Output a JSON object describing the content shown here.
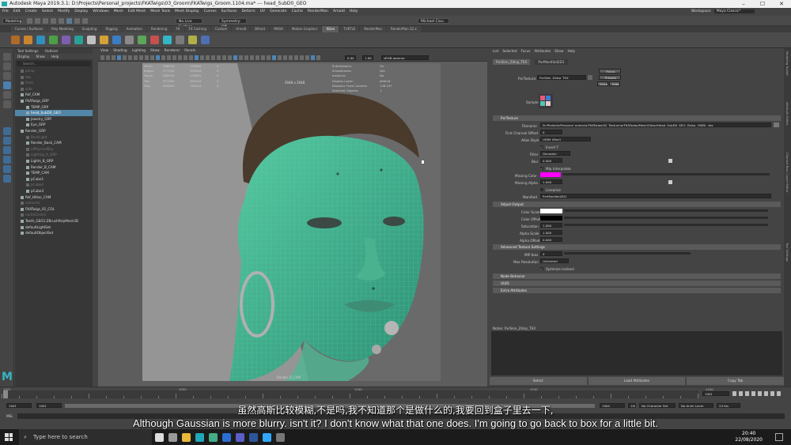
{
  "window": {
    "title": "Autodesk Maya 2019.3.1: D:\\Projects\\Personal_projects\\FKATwigs\\03_Groom\\FKATwigs_Groom.1104.ma* --- head_SubD0_GEO"
  },
  "menubar": {
    "items": [
      "File",
      "Edit",
      "Create",
      "Select",
      "Modify",
      "Display",
      "Windows",
      "Mesh",
      "Edit Mesh",
      "Mesh Tools",
      "Mesh Display",
      "Curves",
      "Surfaces",
      "Deform",
      "UV",
      "Generate",
      "Cache",
      "RenderMan",
      "Arnold",
      "Help"
    ]
  },
  "workspace": {
    "label": "Workspace:",
    "value": "Maya Classic*"
  },
  "status": {
    "mode": "Modeling",
    "no_live": "No Live Surface",
    "symmetry": "Symmetry: Off",
    "user": "Michael Cieu"
  },
  "shelf_tabs": [
    "Curves / Surfaces",
    "Poly Modeling",
    "Sculpting",
    "Rigging",
    "Animation",
    "Rendering",
    "FX",
    "FX Caching",
    "Custom",
    "Arnold",
    "Bifrost",
    "MASH",
    "Motion Graphics",
    "XGen",
    "TURTLE",
    "RenderMan",
    "RenderMan 22.x"
  ],
  "outliner": {
    "tabs": [
      "Tool Settings",
      "Outliner"
    ],
    "menu": [
      "Display",
      "Show",
      "Help"
    ],
    "search_placeholder": "Search...",
    "items": [
      {
        "label": "persp",
        "dim": true,
        "indent": 1
      },
      {
        "label": "top",
        "dim": true,
        "indent": 1
      },
      {
        "label": "front",
        "dim": true,
        "indent": 1
      },
      {
        "label": "side",
        "dim": true,
        "indent": 1
      },
      {
        "label": "Ref_CAM",
        "indent": 1
      },
      {
        "label": "FKATwigs_GRP",
        "indent": 1
      },
      {
        "label": "TEMP_GRP",
        "indent": 2
      },
      {
        "label": "head_SubD0_GEO",
        "indent": 2,
        "selected": true
      },
      {
        "label": "Jewelry_GRP",
        "indent": 2
      },
      {
        "label": "Eye_GRP",
        "indent": 2
      },
      {
        "label": "Render_GRP",
        "indent": 1
      },
      {
        "label": "BackLight",
        "dim": true,
        "indent": 2
      },
      {
        "label": "Render_Back_CAM",
        "indent": 2
      },
      {
        "label": "aiPhysicalSky",
        "dim": true,
        "indent": 2
      },
      {
        "label": "Lighting_A_GRP",
        "dim": true,
        "indent": 2
      },
      {
        "label": "Lights_B_GRP",
        "indent": 2
      },
      {
        "label": "Render_B_CAM",
        "indent": 2
      },
      {
        "label": "TEMP_CAM",
        "indent": 2
      },
      {
        "label": "pCube1",
        "indent": 2
      },
      {
        "label": "pCube2",
        "dim": true,
        "indent": 2
      },
      {
        "label": "pCube3",
        "indent": 2
      },
      {
        "label": "Ref_Hiltac_CAM",
        "indent": 1
      },
      {
        "label": "camera1",
        "dim": true,
        "indent": 1
      },
      {
        "label": "FKATwigs_01_COL",
        "indent": 1
      },
      {
        "label": "nurbsCircle1",
        "dim": true,
        "indent": 1
      },
      {
        "label": "Teeth_GEO1:ZBrushPolyMesh3D",
        "indent": 1
      },
      {
        "label": "defaultLightSet",
        "indent": 1
      },
      {
        "label": "defaultObjectSet",
        "indent": 1
      }
    ]
  },
  "viewport": {
    "menu": [
      "View",
      "Shading",
      "Lighting",
      "Show",
      "Renderer",
      "Panels"
    ],
    "exposure": "0.00",
    "gamma": "1.00",
    "color_space": "sRGB gamma",
    "resolution": "2048 x 2048",
    "camera": "Render_B_CAM",
    "hud_left": {
      "rows": [
        [
          "Verts:",
          "288030",
          "176600",
          "0"
        ],
        [
          "Edges:",
          "577430",
          "353618",
          "0"
        ],
        [
          "Faces:",
          "289549",
          "176602",
          "0"
        ],
        [
          "Tris:",
          "577282",
          "353204",
          "0"
        ],
        [
          "UVs:",
          "494600",
          "194010",
          "0"
        ]
      ]
    },
    "hud_right": {
      "rows": [
        [
          "Subdivisions:",
          "On"
        ],
        [
          "Smoothness:",
          "N/A"
        ],
        [
          "Instance:",
          "No"
        ],
        [
          "Display Layer:",
          "default"
        ],
        [
          "Distance From Camera:",
          "138.197"
        ],
        [
          "Selected Objects:",
          "1"
        ]
      ]
    }
  },
  "attribute_editor": {
    "tabs": [
      "List",
      "Selected",
      "Focus",
      "Attributes",
      "Show",
      "Help"
    ],
    "node_tabs": [
      "PxrSkin_Zdisp_TEX",
      "PxrManifold2D1"
    ],
    "node_label": "PxrTexture:",
    "node_value": "PxrSkin_Zdisp_TEX",
    "focus_btn": "Focus",
    "presets_btn": "Presets",
    "show_btn": "Show",
    "hide_btn": "Hide",
    "sample_label": "Sample",
    "sections": {
      "pxrtexture": "PxrTexture",
      "adjust": "Adjust Output",
      "advanced": "Advanced Texture Settings",
      "node_behavior": "Node Behavior",
      "uuid": "UUID",
      "extra": "Extra Attributes"
    },
    "fields": {
      "filename_label": "Filename",
      "filename": "D:/Projects/Personal_projects/FKATwigs/02_Texturing/FKATwigs/Mesh/Zdisp/Head_SubD0_GEO_Zdisp_.MARI_.tex",
      "first_channel_label": "First Channel Offset",
      "first_channel": "0",
      "atlas_label": "Atlas Style",
      "atlas": "UDIM (Mari)",
      "invert_t": "Invert T",
      "filter_label": "Filter",
      "filter": "Gaussian",
      "blur_label": "Blur",
      "blur": "0.000",
      "mip_interp": "Mip Interpolate",
      "missing_color_label": "Missing Color",
      "missing_alpha_label": "Missing Alpha",
      "missing_alpha": "1.000",
      "linearize": "Linearize",
      "manifold_label": "Manifold",
      "manifold": "PxrManifold2D1",
      "color_scale_label": "Color Scale",
      "color_offset_label": "Color Offset",
      "saturation_label": "Saturation",
      "saturation": "1.000",
      "alpha_scale_label": "Alpha Scale",
      "alpha_scale": "1.000",
      "alpha_offset_label": "Alpha Offset",
      "alpha_offset": "0.000",
      "mip_bias_label": "MIP bias",
      "mip_bias": "0",
      "max_res_label": "Max Resolution",
      "max_res": "Unlimited",
      "opt_indirect": "Optimize Indirect"
    },
    "notes_label": "Notes: PxrSkin_Zdisp_TEX",
    "buttons": [
      "Select",
      "Load Attributes",
      "Copy Tab"
    ],
    "colors": {
      "missing_color": "#ff00ff",
      "color_scale": "#ffffff",
      "color_offset": "#000000"
    }
  },
  "right_tabs": [
    "Modeling Toolkit",
    "Attribute Editor",
    "Channel Box / Layer Editor",
    "Tool Settings"
  ],
  "timeline": {
    "ticks": [
      "1001",
      "1050",
      "1100",
      "1150",
      "1200"
    ],
    "current": "1001",
    "current_right": "1001",
    "range_start": "1001",
    "range_inner_start": "1001",
    "range_inner_end": "1004",
    "range_end": "1004",
    "no_char_set": "No Character Set",
    "no_anim_layer": "No Anim Layer",
    "fps": "24 fps"
  },
  "mel": {
    "label": "MEL"
  },
  "subtitles": {
    "chinese": "虽然高斯比较模糊,不是吗,我不知道那个是做什么的,我要回到盒子里去一下,",
    "english": "Although Gaussian is more blurry. isn't it? I don't know what that one does. I'm going to go back to box for a little bit."
  },
  "taskbar": {
    "search": "Type here to search",
    "time": "20:40",
    "date": "22/08/2020"
  }
}
